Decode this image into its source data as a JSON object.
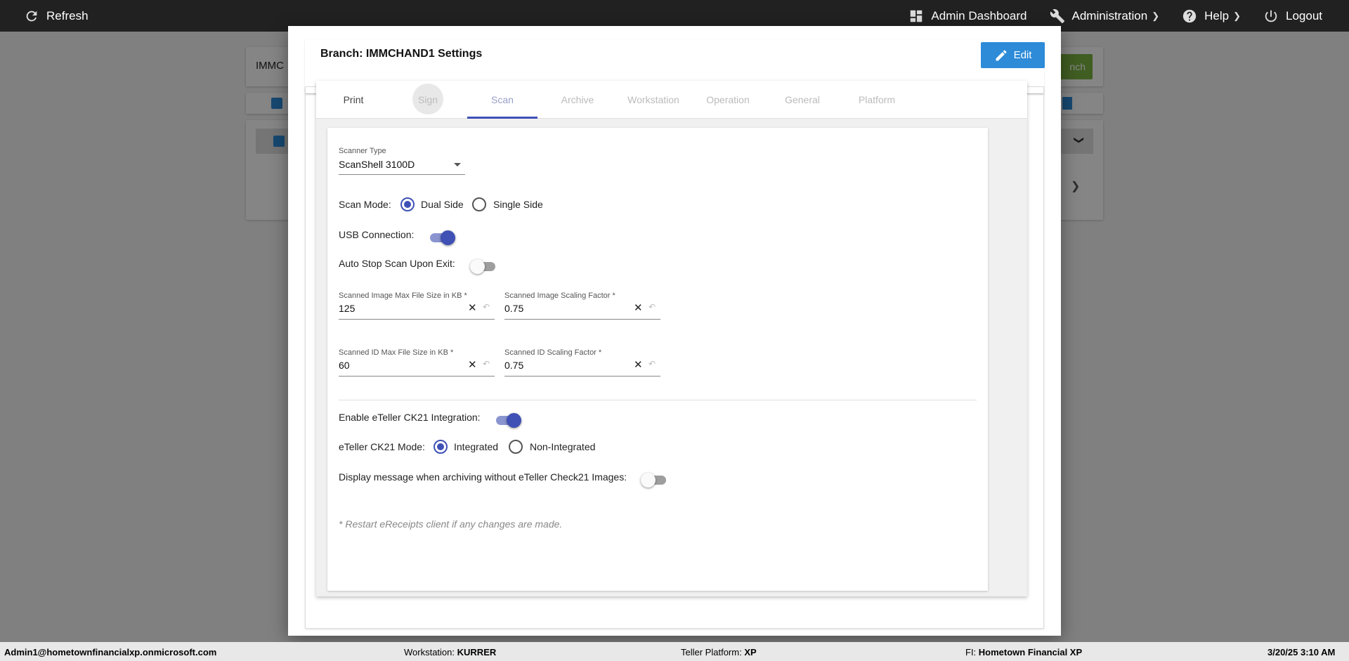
{
  "topbar": {
    "refresh_label": "Refresh",
    "admin_dashboard_label": "Admin Dashboard",
    "administration_label": "Administration",
    "help_label": "Help",
    "logout_label": "Logout"
  },
  "background": {
    "search_text": "IMMC",
    "branch_button": "nch"
  },
  "modal": {
    "title": "Branch: IMMCHAND1 Settings",
    "edit_label": "Edit",
    "tabs": [
      {
        "label": "Print"
      },
      {
        "label": "Sign"
      },
      {
        "label": "Scan"
      },
      {
        "label": "Archive"
      },
      {
        "label": "Workstation"
      },
      {
        "label": "Operation"
      },
      {
        "label": "General"
      },
      {
        "label": "Platform"
      }
    ],
    "active_tab": "Scan",
    "scan": {
      "scanner_type_label": "Scanner Type",
      "scanner_type_value": "ScanShell 3100D",
      "scan_mode_label": "Scan Mode:",
      "scan_mode_options": [
        "Dual Side",
        "Single Side"
      ],
      "scan_mode_selected": "Dual Side",
      "usb_label": "USB Connection:",
      "usb_on": true,
      "auto_stop_label": "Auto Stop Scan Upon Exit:",
      "auto_stop_on": false,
      "img_max_label": "Scanned Image Max File Size in KB *",
      "img_max_value": "125",
      "img_scale_label": "Scanned Image Scaling Factor *",
      "img_scale_value": "0.75",
      "id_max_label": "Scanned ID Max File Size in KB *",
      "id_max_value": "60",
      "id_scale_label": "Scanned ID Scaling Factor *",
      "id_scale_value": "0.75",
      "ck21_label": "Enable eTeller CK21 Integration:",
      "ck21_on": true,
      "ck21_mode_label": "eTeller CK21 Mode:",
      "ck21_mode_options": [
        "Integrated",
        "Non-Integrated"
      ],
      "ck21_mode_selected": "Integrated",
      "display_msg_label": "Display message when archiving without eTeller Check21 Images:",
      "display_msg_on": false,
      "note": "* Restart eReceipts client if any changes are made."
    }
  },
  "statusbar": {
    "user": "Admin1@hometownfinancialxp.onmicrosoft.com",
    "workstation_label": "Workstation:",
    "workstation_value": "KURRER",
    "platform_label": "Teller Platform:",
    "platform_value": "XP",
    "fi_label": "FI:",
    "fi_value": "Hometown Financial XP",
    "datetime": "3/20/25 3:10 AM"
  },
  "colors": {
    "topbar": "#212121",
    "accent": "#3f51b5",
    "edit_button": "#2d8bd8"
  }
}
